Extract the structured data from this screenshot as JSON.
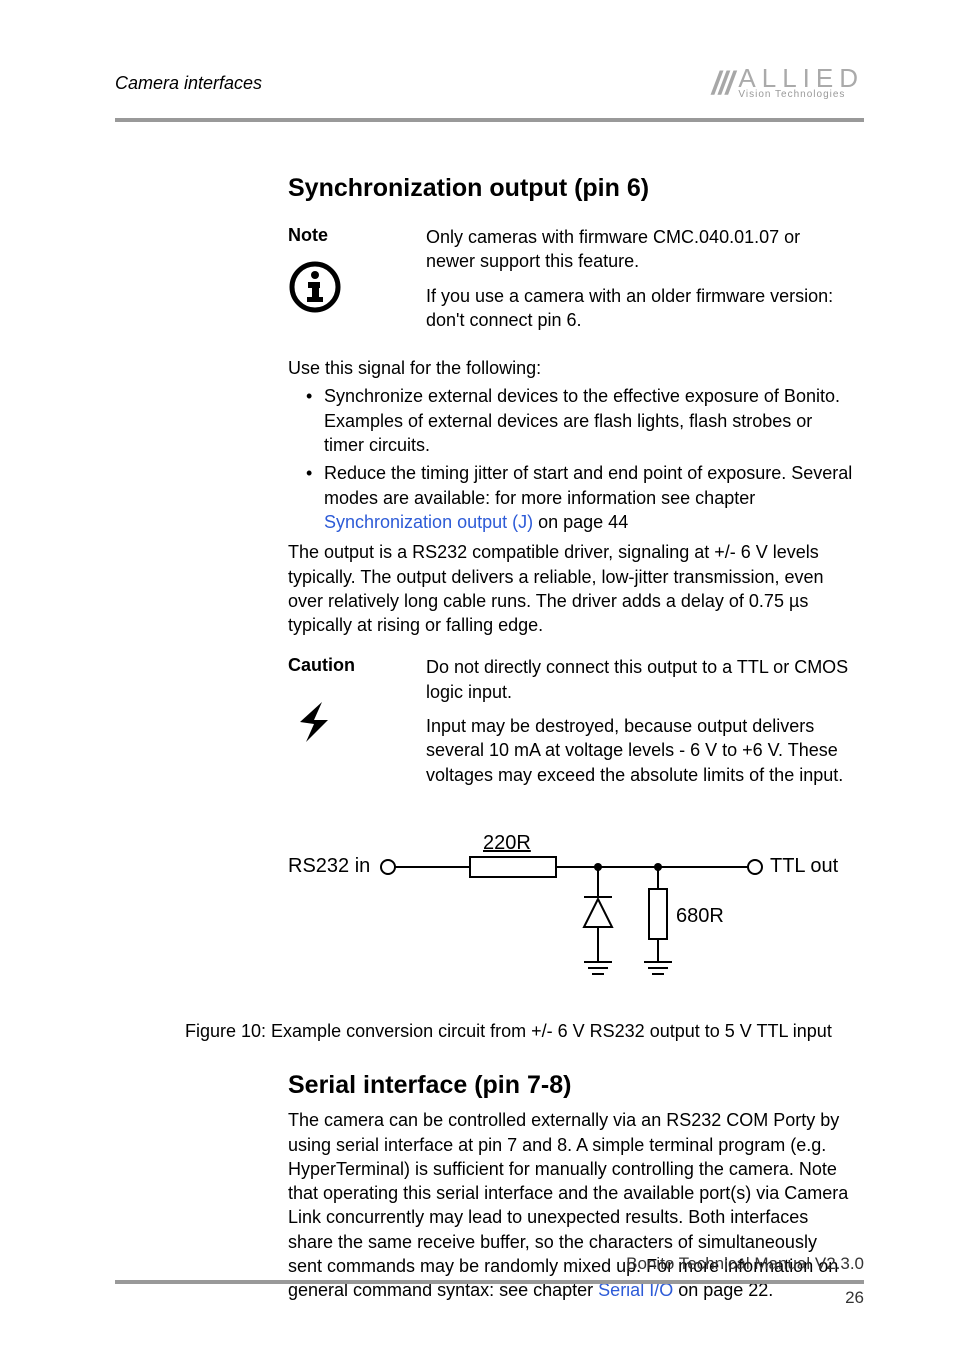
{
  "header": {
    "section": "Camera interfaces",
    "logo_main": "ALLIED",
    "logo_sub": "Vision Technologies"
  },
  "h1": "Synchronization output (pin 6)",
  "note": {
    "label": "Note",
    "p1": "Only cameras with firmware CMC.040.01.07 or newer support this feature.",
    "p2": "If you use a camera with an older firmware version: don't connect pin 6."
  },
  "p_use": "Use this signal for the following:",
  "bullets": {
    "b1": "Synchronize external devices to the effective exposure of Bonito. Examples of external devices are flash lights, flash strobes or timer circuits.",
    "b2_a": "Reduce the timing jitter of start and end point of exposure. Several modes are available: for more information see chapter ",
    "b2_link": "Synchronization output (J)",
    "b2_b": " on page 44"
  },
  "p_output": "The output is a RS232 compatible driver, signaling at +/- 6 V levels typically. The output delivers a reliable, low-jitter transmission, even over relatively long cable runs. The driver adds a delay of 0.75 µs typically at rising or falling edge.",
  "caution": {
    "label": "Caution",
    "p1": "Do not directly connect this output to a TTL or CMOS logic input.",
    "p2": "Input may be destroyed, because output delivers several 10 mA at voltage levels - 6 V to +6 V. These voltages may exceed the absolute limits of the input."
  },
  "diagram": {
    "in_label": "RS232 in",
    "r1": "220R",
    "r2": "680R",
    "out_label": "TTL out"
  },
  "figcap": "Figure 10: Example conversion circuit from +/- 6 V RS232 output to 5 V TTL input",
  "h2": "Serial interface (pin 7-8)",
  "serial": {
    "p_a": "The camera can be controlled externally via an RS232 COM Porty by using serial interface at pin 7 and 8. A simple terminal program (e.g. HyperTerminal) is sufficient for manually controlling the camera. Note that operating this serial interface and the available port(s) via Camera Link concurrently may lead to unexpected results. Both interfaces share the same receive buffer, so the characters of simultaneously sent commands may be randomly mixed up. For more information on general command syntax: see chapter ",
    "link": "Serial I/O",
    "p_b": " on page 22."
  },
  "footer": {
    "doc": "Bonito Technical Manual V2.3.0",
    "page": "26"
  }
}
